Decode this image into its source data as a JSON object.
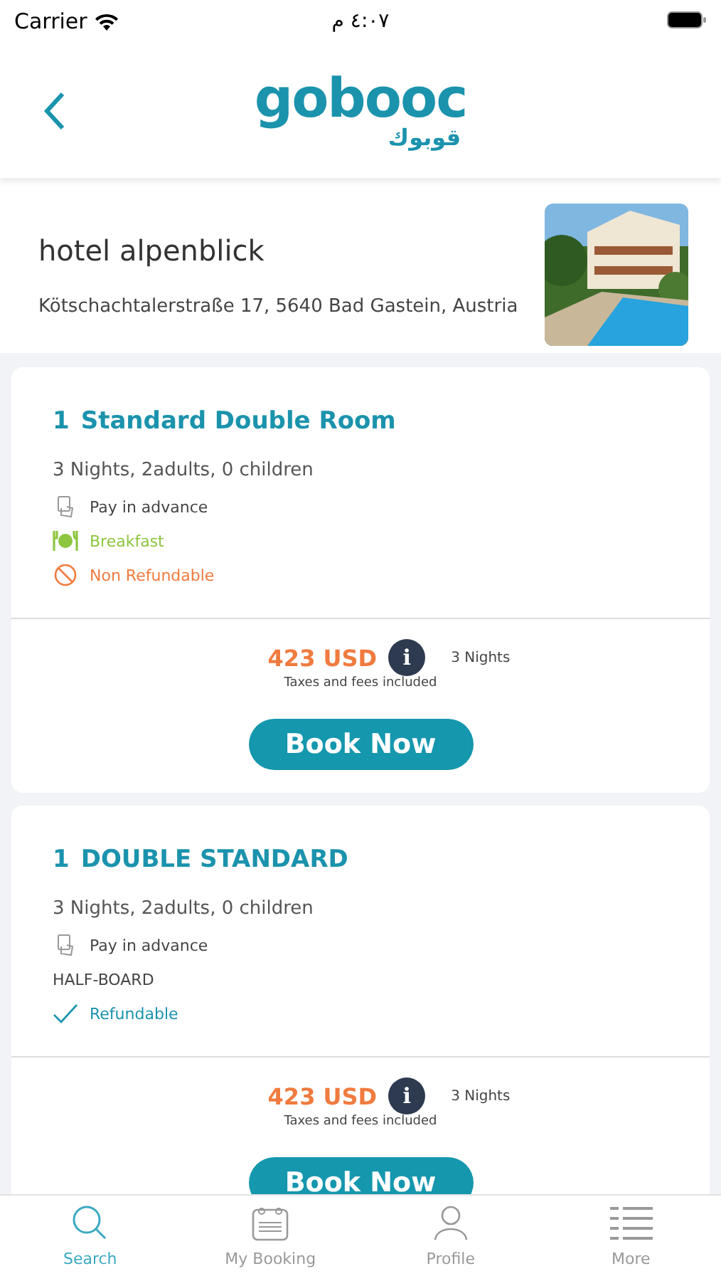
{
  "status_bar": {
    "carrier": "Carrier",
    "time": "٤:٠٧ م"
  },
  "header": {
    "logo": "gobooc",
    "logo_arabic": "قوبوك"
  },
  "hotel": {
    "name": "hotel alpenblick",
    "address": "Kötschachtalerstraße 17, 5640 Bad Gastein, Austria"
  },
  "rooms": [
    {
      "count": "1",
      "title": "Standard Double Room",
      "occupancy": "3 Nights, 2adults, 0 children",
      "features": [
        {
          "kind": "payment",
          "text": "Pay in advance"
        },
        {
          "kind": "meal",
          "text": "Breakfast"
        },
        {
          "kind": "non_refundable",
          "text": "Non Refundable"
        }
      ],
      "price": "423 USD",
      "info": "i",
      "nights": "3 Nights",
      "tax_note": "Taxes and fees included",
      "button": "Book Now"
    },
    {
      "count": "1",
      "title": "DOUBLE STANDARD",
      "occupancy": "3 Nights, 2adults, 0 children",
      "features": [
        {
          "kind": "payment",
          "text": "Pay in advance"
        },
        {
          "kind": "plain",
          "text": "HALF-BOARD"
        },
        {
          "kind": "refundable",
          "text": "Refundable"
        }
      ],
      "price": "423 USD",
      "info": "i",
      "nights": "3 Nights",
      "tax_note": "Taxes and fees included",
      "button": "Book Now"
    }
  ],
  "tab_bar": [
    {
      "kind": "search",
      "label": "Search",
      "selected": true
    },
    {
      "kind": "booking",
      "label": "My Booking",
      "selected": false
    },
    {
      "kind": "profile",
      "label": "Profile",
      "selected": false
    },
    {
      "kind": "more",
      "label": "More",
      "selected": false
    }
  ]
}
